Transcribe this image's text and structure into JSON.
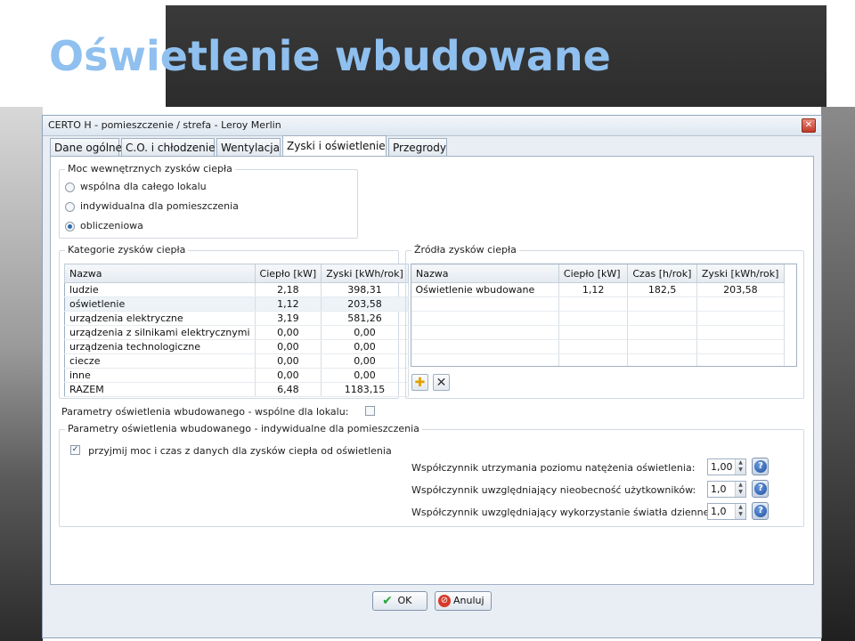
{
  "slide": {
    "title": "Oświetlenie wbudowane"
  },
  "window": {
    "title": "CERTO H - pomieszczenie / strefa - Leroy Merlin",
    "close_symbol": "✕"
  },
  "tabs": [
    {
      "label": "Dane ogólne"
    },
    {
      "label": "C.O. i chłodzenie"
    },
    {
      "label": "Wentylacja"
    },
    {
      "label": "Zyski i oświetlenie"
    },
    {
      "label": "Przegrody"
    }
  ],
  "moc_group": {
    "legend": "Moc wewnętrznych zysków ciepła",
    "options": [
      {
        "label": "wspólna dla całego lokalu",
        "selected": false
      },
      {
        "label": "indywidualna dla pomieszczenia",
        "selected": false
      },
      {
        "label": "obliczeniowa",
        "selected": true
      }
    ]
  },
  "kategorie": {
    "legend": "Kategorie zysków ciepła",
    "headers": [
      "Nazwa",
      "Ciepło [kW]",
      "Zyski [kWh/rok]"
    ],
    "rows": [
      [
        "ludzie",
        "2,18",
        "398,31"
      ],
      [
        "oświetlenie",
        "1,12",
        "203,58"
      ],
      [
        "urządzenia elektryczne",
        "3,19",
        "581,26"
      ],
      [
        "urządzenia z silnikami elektrycznymi",
        "0,00",
        "0,00"
      ],
      [
        "urządzenia technologiczne",
        "0,00",
        "0,00"
      ],
      [
        "ciecze",
        "0,00",
        "0,00"
      ],
      [
        "inne",
        "0,00",
        "0,00"
      ],
      [
        "RAZEM",
        "6,48",
        "1183,15"
      ]
    ]
  },
  "zrodla": {
    "legend": "Źródła zysków ciepła",
    "headers": [
      "Nazwa",
      "Ciepło [kW]",
      "Czas [h/rok]",
      "Zyski [kWh/rok]"
    ],
    "rows": [
      [
        "Oświetlenie wbudowane",
        "1,12",
        "182,5",
        "203,58"
      ]
    ],
    "add_icon": "add-icon",
    "delete_icon": "delete-icon"
  },
  "param_wspolne": {
    "label": "Parametry oświetlenia wbudowanego - wspólne dla lokalu:",
    "checked": false
  },
  "param_indyw": {
    "legend": "Parametry oświetlenia wbudowanego - indywidualne dla pomieszczenia",
    "checkbox_label": "przyjmij moc i czas z danych dla zysków ciepła od oświetlenia",
    "checked": true,
    "coefficients": [
      {
        "label": "Współczynnik utrzymania poziomu natężenia oświetlenia:",
        "value": "1,00"
      },
      {
        "label": "Współczynnik uwzględniający nieobecność użytkowników:",
        "value": "1,0"
      },
      {
        "label": "Współczynnik uwzględniający wykorzystanie światła dziennego:",
        "value": "1,0"
      }
    ]
  },
  "footer": {
    "ok_label": "OK",
    "cancel_label": "Anuluj"
  },
  "colors": {
    "title": "#8fc0ef",
    "window_bg": "#e9eef4",
    "accent": "#2a6db0"
  }
}
